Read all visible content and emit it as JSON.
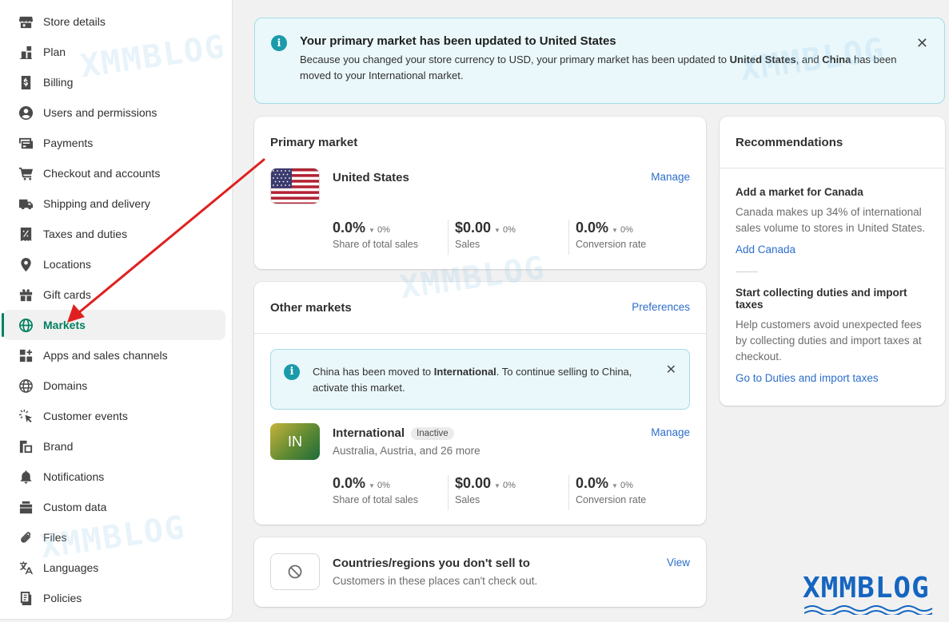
{
  "sidebar": {
    "items": [
      {
        "label": "Store details",
        "icon": "store-icon"
      },
      {
        "label": "Plan",
        "icon": "plan-icon"
      },
      {
        "label": "Billing",
        "icon": "billing-icon"
      },
      {
        "label": "Users and permissions",
        "icon": "user-icon"
      },
      {
        "label": "Payments",
        "icon": "payments-icon"
      },
      {
        "label": "Checkout and accounts",
        "icon": "cart-icon"
      },
      {
        "label": "Shipping and delivery",
        "icon": "truck-icon"
      },
      {
        "label": "Taxes and duties",
        "icon": "receipt-icon"
      },
      {
        "label": "Locations",
        "icon": "location-icon"
      },
      {
        "label": "Gift cards",
        "icon": "gift-icon"
      },
      {
        "label": "Markets",
        "icon": "globe-icon",
        "active": true
      },
      {
        "label": "Apps and sales channels",
        "icon": "apps-icon"
      },
      {
        "label": "Domains",
        "icon": "domain-globe-icon"
      },
      {
        "label": "Customer events",
        "icon": "cursor-click-icon"
      },
      {
        "label": "Brand",
        "icon": "brand-icon"
      },
      {
        "label": "Notifications",
        "icon": "bell-icon"
      },
      {
        "label": "Custom data",
        "icon": "database-icon"
      },
      {
        "label": "Files",
        "icon": "paperclip-icon"
      },
      {
        "label": "Languages",
        "icon": "translate-icon"
      },
      {
        "label": "Policies",
        "icon": "document-icon"
      }
    ]
  },
  "banner": {
    "title": "Your primary market has been updated to United States",
    "text_1": "Because you changed your store currency to USD, your primary market has been updated to ",
    "bold_1": "United States",
    "text_2": ", and ",
    "bold_2": "China",
    "text_3": " has been moved to your International market."
  },
  "primary_market": {
    "title": "Primary market",
    "market_name": "United States",
    "manage_label": "Manage",
    "metrics": [
      {
        "value": "0.0%",
        "delta": "0%",
        "label": "Share of total sales"
      },
      {
        "value": "$0.00",
        "delta": "0%",
        "label": "Sales"
      },
      {
        "value": "0.0%",
        "delta": "0%",
        "label": "Conversion rate"
      }
    ]
  },
  "other_markets": {
    "title": "Other markets",
    "preferences_label": "Preferences",
    "notice": {
      "text_1": "China has been moved to ",
      "bold": "International",
      "text_2": ". To continue selling to China, activate this market."
    },
    "market": {
      "badge": "IN",
      "name": "International",
      "status": "Inactive",
      "subtitle": "Australia, Austria, and 26 more",
      "manage_label": "Manage"
    },
    "metrics": [
      {
        "value": "0.0%",
        "delta": "0%",
        "label": "Share of total sales"
      },
      {
        "value": "$0.00",
        "delta": "0%",
        "label": "Sales"
      },
      {
        "value": "0.0%",
        "delta": "0%",
        "label": "Conversion rate"
      }
    ]
  },
  "excluded": {
    "title": "Countries/regions you don't sell to",
    "subtitle": "Customers in these places can't check out.",
    "view_label": "View"
  },
  "recommendations": {
    "title": "Recommendations",
    "items": [
      {
        "title": "Add a market for Canada",
        "text": "Canada makes up 34% of international sales volume to stores in United States.",
        "link": "Add Canada"
      },
      {
        "title": "Start collecting duties and import taxes",
        "text": "Help customers avoid unexpected fees by collecting duties and import taxes at checkout.",
        "link": "Go to Duties and import taxes"
      }
    ]
  },
  "watermark": "XMMBLOG",
  "colors": {
    "accent_green": "#007f5f",
    "link_blue": "#2c6ecb",
    "info_bg": "#eaf8fb",
    "info_border": "#a6dbe6",
    "arrow_red": "#e02020",
    "logo_blue": "#1565c0"
  }
}
